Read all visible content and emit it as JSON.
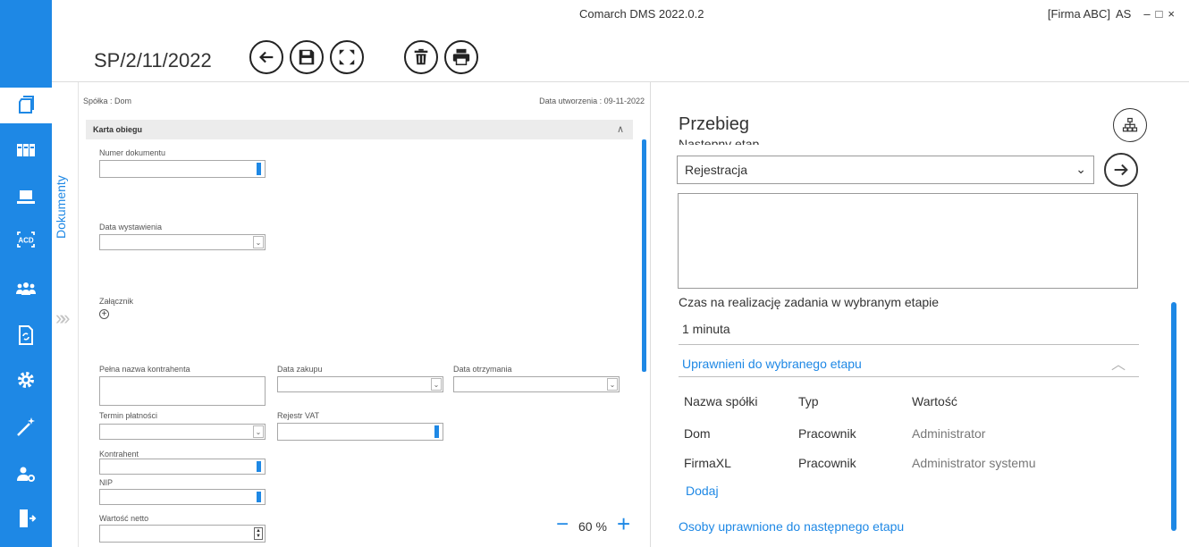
{
  "window": {
    "app_title": "Comarch DMS 2022.0.2",
    "company": "[Firma ABC]",
    "user": "AS",
    "minimize": "–",
    "maximize": "□",
    "close": "×"
  },
  "toolbar": {
    "doc_number": "SP/2/11/2022",
    "back_icon": "back-arrow-icon",
    "save_icon": "save-icon",
    "fullscreen_icon": "fullscreen-icon",
    "delete_icon": "trash-icon",
    "print_icon": "printer-icon"
  },
  "sidebar": {
    "accent": "#1e88e5",
    "items": [
      {
        "icon": "documents-icon",
        "active": true
      },
      {
        "icon": "kanban-icon"
      },
      {
        "icon": "laptop-icon"
      },
      {
        "icon": "acd-icon",
        "text": "ACD"
      },
      {
        "icon": "users-icon"
      },
      {
        "icon": "document-sync-icon"
      },
      {
        "icon": "gear-icon"
      },
      {
        "icon": "magic-wand-icon"
      },
      {
        "icon": "user-settings-icon"
      },
      {
        "icon": "logout-icon"
      }
    ]
  },
  "doc_tab": {
    "label": "Dokumenty",
    "collapse": "»"
  },
  "form": {
    "company_label": "Spółka : Dom",
    "created_label": "Data utworzenia : 09-11-2022",
    "section_title": "Karta obiegu",
    "section_chevron": "∧",
    "fields": {
      "numer_dokumentu": "Numer dokumentu",
      "data_wystawienia": "Data wystawienia",
      "zalacznik": "Załącznik",
      "pelna_nazwa": "Pełna nazwa kontrahenta",
      "data_zakupu": "Data zakupu",
      "data_otrzymania": "Data otrzymania",
      "termin_platnosci": "Termin płatności",
      "rejestr_vat": "Rejestr VAT",
      "kontrahent": "Kontrahent",
      "nip": "NIP",
      "wartosc_netto": "Wartość netto"
    },
    "zoom": {
      "minus": "−",
      "value": "60 %",
      "plus": "+"
    }
  },
  "przebieg": {
    "title": "Przebieg",
    "next_stage_label": "Następny etap",
    "stage_selected": "Rejestracja",
    "note_value": "",
    "time_label": "Czas na realizację zadania w wybranym etapie",
    "time_value": "1 minuta",
    "authorized_header": "Uprawnieni do wybranego etapu",
    "table": {
      "columns": [
        "Nazwa spółki",
        "Typ",
        "Wartość"
      ],
      "rows": [
        [
          "Dom",
          "Pracownik",
          "Administrator"
        ],
        [
          "FirmaXL",
          "Pracownik",
          "Administrator systemu"
        ]
      ]
    },
    "add_link": "Dodaj",
    "next_persons_link": "Osoby uprawnione do następnego etapu"
  }
}
